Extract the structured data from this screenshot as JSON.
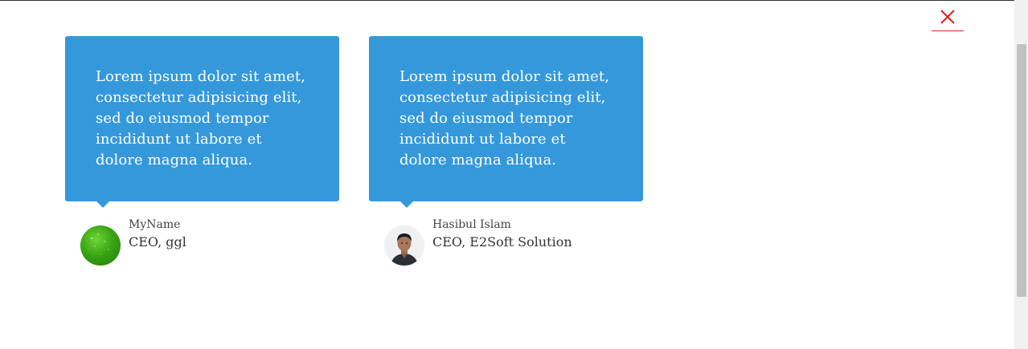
{
  "testimonials": [
    {
      "quote": "Lorem ipsum dolor sit amet, consectetur adipisicing elit, sed do eiusmod tempor incididunt ut labore et dolore magna aliqua.",
      "name": "MyName",
      "role": "CEO, ggl",
      "avatar": "green-ball-avatar"
    },
    {
      "quote": "Lorem ipsum dolor sit amet, consectetur adipisicing elit, sed do eiusmod tempor incididunt ut labore et dolore magna aliqua.",
      "name": "Hasibul Islam",
      "role": "CEO, E2Soft Solution",
      "avatar": "person-photo-avatar"
    }
  ],
  "close_icon": "close-x-icon",
  "colors": {
    "bubble": "#3498db",
    "close": "#d9231b",
    "text_light": "#ffffff",
    "text_dark": "#333333"
  }
}
